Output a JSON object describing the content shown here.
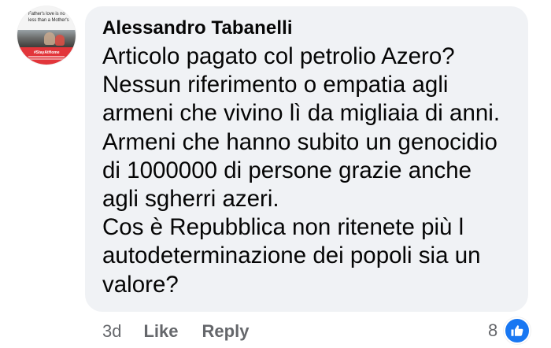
{
  "avatar": {
    "caption": "Father's love is no less than a Mother's",
    "badge": "#StayAtHome"
  },
  "comment": {
    "author": "Alessandro Tabanelli",
    "lines": [
      "Articolo pagato col petrolio Azero?",
      "Nessun riferimento o empatia agli",
      "armeni che vivino lì da migliaia di anni.",
      "Armeni che hanno subito un genocidio",
      "di 1000000 di persone grazie anche",
      "agli sgherri azeri.",
      "Cos è Repubblica non ritenete più l",
      "autodeterminazione dei popoli sia un",
      "valore?"
    ]
  },
  "footer": {
    "time": "3d",
    "like_label": "Like",
    "reply_label": "Reply"
  },
  "reactions": {
    "count": "8",
    "icon": "thumbs-up-icon"
  },
  "colors": {
    "bubble": "#f0f2f5",
    "text": "#050505",
    "secondary": "#65676b",
    "like_blue": "#1877f2",
    "badge_red": "#e2353a"
  }
}
